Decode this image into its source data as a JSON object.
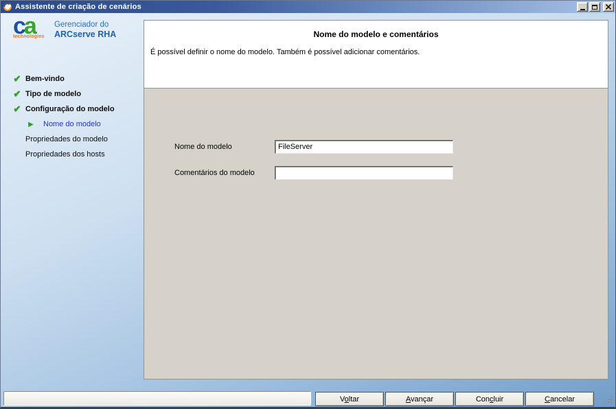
{
  "titlebar": {
    "title": "Assistente de criação de cenários",
    "icon": "scenario-wizard-swirl-icon",
    "controls": [
      "minimize-icon",
      "maximize-icon",
      "close-icon"
    ]
  },
  "colors": {
    "titlebar_gradient_start": "#2b4a8b",
    "titlebar_gradient_end": "#a9c3e7",
    "accent_green": "#2f9e2c",
    "active_step_blue": "#2433cf",
    "form_background": "#d6d2c9",
    "brand_blue": "#1d509f",
    "brand_green": "#3aa32f",
    "brand_orange": "#e87722"
  },
  "sidebar": {
    "logo": {
      "c": "c",
      "a": "a",
      "subtext": "technologies"
    },
    "product": {
      "line1": "Gerenciador do",
      "line2": "ARCserve RHA"
    },
    "steps": [
      {
        "label": "Bem-vindo",
        "state": "done"
      },
      {
        "label": "Tipo de modelo",
        "state": "done"
      },
      {
        "label": "Configuração do modelo",
        "state": "done"
      },
      {
        "label": "Nome do modelo",
        "state": "current"
      },
      {
        "label": "Propriedades do modelo",
        "state": "pending"
      },
      {
        "label": "Propriedades dos hosts",
        "state": "pending"
      }
    ]
  },
  "icons": {
    "check": "✔",
    "current_arrow": "▶"
  },
  "header": {
    "title": "Nome do modelo e comentários",
    "description": "É possível definir o nome do modelo. Também é possível adicionar comentários."
  },
  "form": {
    "name_label": "Nome do modelo",
    "name_value": "FileServer",
    "comments_label": "Comentários do modelo",
    "comments_value": ""
  },
  "footer": {
    "buttons": [
      {
        "id": "voltar",
        "pre": "V",
        "key": "o",
        "post": "ltar"
      },
      {
        "id": "avancar",
        "pre": "",
        "key": "A",
        "post": "vançar"
      },
      {
        "id": "concluir",
        "pre": "Con",
        "key": "c",
        "post": "luir"
      },
      {
        "id": "cancelar",
        "pre": "",
        "key": "C",
        "post": "ancelar"
      }
    ]
  }
}
